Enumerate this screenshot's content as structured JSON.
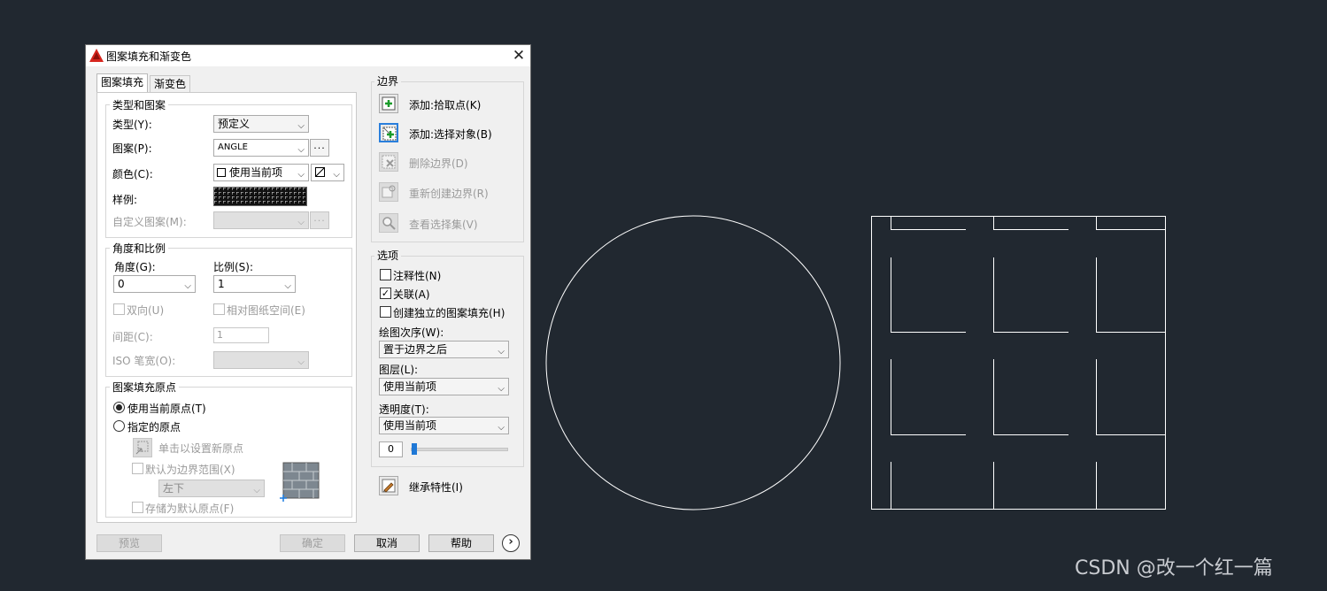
{
  "dialog": {
    "title": "图案填充和渐变色",
    "tabs": [
      "图案填充",
      "渐变色"
    ],
    "type_and_pattern": {
      "title": "类型和图案",
      "type_label": "类型(Y):",
      "type_value": "预定义",
      "pattern_label": "图案(P):",
      "pattern_value": "ANGLE",
      "color_label": "颜色(C):",
      "color_value": "使用当前项",
      "sample_label": "样例:",
      "custom_label": "自定义图案(M):"
    },
    "angle_scale": {
      "title": "角度和比例",
      "angle_label": "角度(G):",
      "angle_value": "0",
      "scale_label": "比例(S):",
      "scale_value": "1",
      "double_label": "双向(U)",
      "relative_label": "相对图纸空间(E)",
      "spacing_label": "间距(C):",
      "spacing_value": "1",
      "iso_label": "ISO 笔宽(O):"
    },
    "origin": {
      "title": "图案填充原点",
      "current_label": "使用当前原点(T)",
      "specified_label": "指定的原点",
      "click_label": "单击以设置新原点",
      "default_extents_label": "默认为边界范围(X)",
      "position_value": "左下",
      "store_label": "存储为默认原点(F)"
    },
    "boundary": {
      "title": "边界",
      "add_pick": "添加:拾取点(K)",
      "add_select": "添加:选择对象(B)",
      "remove": "删除边界(D)",
      "recreate": "重新创建边界(R)",
      "view": "查看选择集(V)"
    },
    "options": {
      "title": "选项",
      "annotative": "注释性(N)",
      "associative": "关联(A)",
      "independent": "创建独立的图案填充(H)",
      "draw_order_label": "绘图次序(W):",
      "draw_order_value": "置于边界之后",
      "layer_label": "图层(L):",
      "layer_value": "使用当前项",
      "transparency_label": "透明度(T):",
      "transparency_value": "使用当前项",
      "transparency_number": "0"
    },
    "inherit": "继承特性(I)",
    "buttons": {
      "preview": "预览",
      "ok": "确定",
      "cancel": "取消",
      "help": "帮助"
    }
  },
  "watermark": "CSDN @改一个红一篇",
  "colors": {
    "canvas_bg": "#212830",
    "drawing_line": "#ffffff",
    "accent": "#2a7fdc"
  },
  "icons": [
    "autocad-logo-icon",
    "close-icon",
    "pick-point-icon",
    "select-objects-icon",
    "remove-boundary-icon",
    "recreate-boundary-icon",
    "magnifier-icon",
    "inherit-properties-icon",
    "more-options-arrow-icon"
  ]
}
